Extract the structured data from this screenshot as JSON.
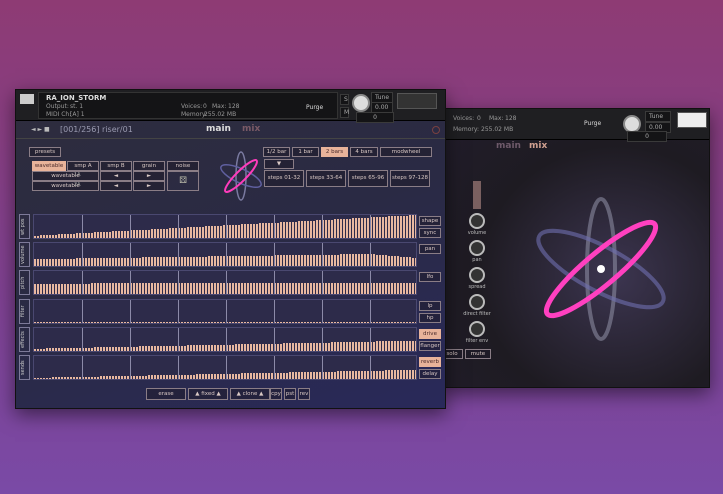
{
  "front": {
    "instrument_name": "RA_ION_STORM",
    "output_label": "Output:",
    "output_value": "st. 1",
    "midi_label": "MIDI Ch:",
    "midi_value": "[A] 1",
    "voices_label": "Voices:",
    "voices_value": "0",
    "max_label": "Max:",
    "max_value": "128",
    "memory_label": "Memory:",
    "memory_value": "255.02 MB",
    "purge": "Purge",
    "tune_label": "Tune",
    "tune_value": "0.00",
    "s_label": "S",
    "m_label": "M",
    "pan_value": "0",
    "preset_name": "[001/256] riser/01",
    "tabs": [
      "main",
      "mix"
    ],
    "presets_button": "presets",
    "source_row": [
      "wavetable",
      "smp A",
      "smp B",
      "grain",
      "noise"
    ],
    "wt1": "wavetable",
    "wt1_val": "1A",
    "wt2": "wavetable",
    "wt2_val": "2A",
    "arrow_left": "◄",
    "arrow_right": "►",
    "rate": [
      "1/2 bar",
      "1 bar",
      "2 bars",
      "4 bars",
      "modwheel"
    ],
    "rate_active": 2,
    "steps": [
      "steps 01-32",
      "steps 33-64",
      "steps 65-96",
      "steps 97-128"
    ],
    "lanes": [
      {
        "label": "wt pos",
        "start": 0.1,
        "end": 1.0,
        "buttons": [
          {
            "t": "shape",
            "on": false
          },
          {
            "t": "sync",
            "on": false
          }
        ]
      },
      {
        "label": "volume",
        "start": 0.3,
        "end": 0.55,
        "fall": 0.2,
        "buttons": [
          {
            "t": "pan",
            "on": false
          }
        ]
      },
      {
        "label": "pitch",
        "start": 0.45,
        "end": 0.5,
        "buttons": [
          {
            "t": "lfo",
            "on": false
          }
        ]
      },
      {
        "label": "filter",
        "start": 0.0,
        "end": 0.0,
        "buttons": [
          {
            "t": "lp",
            "on": false
          },
          {
            "t": "hp",
            "on": false
          }
        ]
      },
      {
        "label": "effects",
        "start": 0.1,
        "end": 0.45,
        "buttons": [
          {
            "t": "drive",
            "on": true
          },
          {
            "t": "flanger",
            "on": false
          }
        ]
      },
      {
        "label": "sends",
        "start": 0.05,
        "end": 0.4,
        "buttons": [
          {
            "t": "reverb",
            "on": true
          },
          {
            "t": "delay",
            "on": false
          }
        ]
      }
    ],
    "bottom": [
      "erase",
      "▲ fixed ▲",
      "▲ clone ▲",
      "cpy",
      "pst",
      "rev"
    ]
  },
  "back": {
    "voices_label": "Voices:",
    "voices_value": "0",
    "max_label": "Max:",
    "max_value": "128",
    "memory_label": "Memory:",
    "memory_value": "255.02 MB",
    "purge": "Purge",
    "tune_label": "Tune",
    "tune_value": "0.00",
    "pan_value": "0",
    "tabs": [
      "main",
      "mix"
    ],
    "knobs": [
      "volume",
      "pan",
      "spread",
      "direct filter",
      "filter env"
    ],
    "solo": "solo",
    "mute": "mute"
  },
  "colors": {
    "accent": "#e8b39a"
  }
}
